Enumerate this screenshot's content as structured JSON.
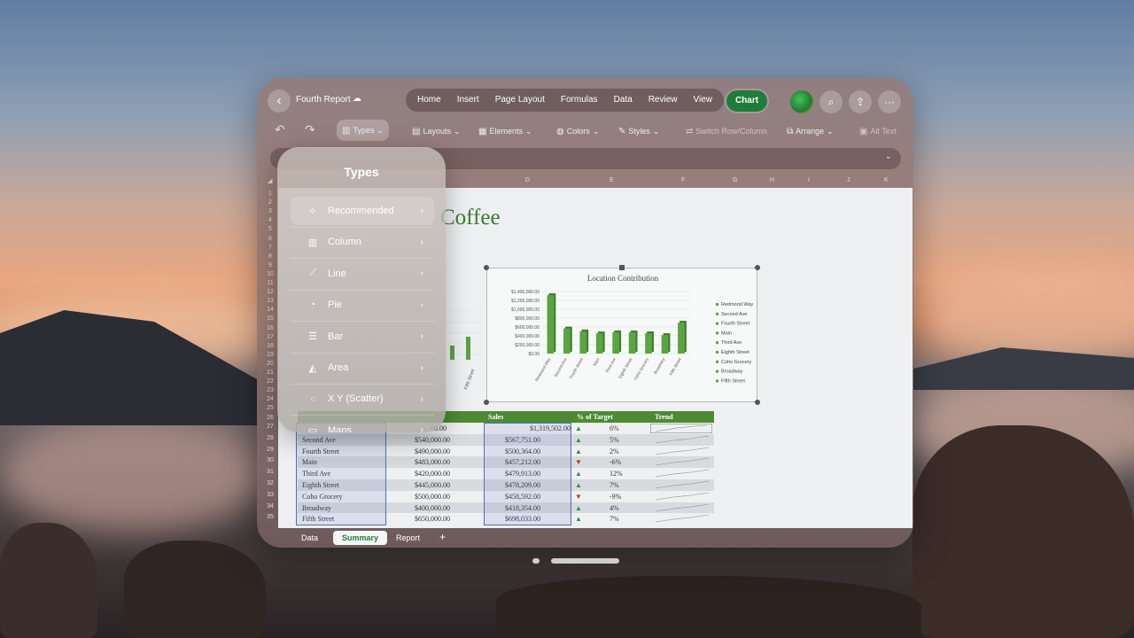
{
  "window": {
    "title": "Fourth Report",
    "tabs": [
      "Home",
      "Insert",
      "Page Layout",
      "Formulas",
      "Data",
      "Review",
      "View"
    ],
    "active_tab": "Chart"
  },
  "ribbon": {
    "types": "Types",
    "layouts": "Layouts",
    "elements": "Elements",
    "colors": "Colors",
    "styles": "Styles",
    "switch": "Switch Row/Column",
    "arrange": "Arrange",
    "alt_text": "Alt Text"
  },
  "columns": [
    "D",
    "E",
    "F",
    "G",
    "H",
    "I",
    "J",
    "K"
  ],
  "rows": [
    "1",
    "2",
    "3",
    "4",
    "5",
    "6",
    "7",
    "8",
    "9",
    "10",
    "11",
    "12",
    "13",
    "14",
    "15",
    "16",
    "17",
    "18",
    "19",
    "20",
    "21",
    "22",
    "23",
    "24",
    "25",
    "26",
    "27",
    "28",
    "29",
    "30",
    "31",
    "32",
    "33",
    "34",
    "35"
  ],
  "sheet_title": "Coffee",
  "types_panel": {
    "title": "Types",
    "items": [
      {
        "label": "Recommended",
        "icon": "wand-icon"
      },
      {
        "label": "Column",
        "icon": "column-chart-icon"
      },
      {
        "label": "Line",
        "icon": "line-chart-icon"
      },
      {
        "label": "Pie",
        "icon": "pie-chart-icon"
      },
      {
        "label": "Bar",
        "icon": "bar-chart-icon"
      },
      {
        "label": "Area",
        "icon": "area-chart-icon"
      },
      {
        "label": "X Y (Scatter)",
        "icon": "scatter-chart-icon"
      },
      {
        "label": "Maps",
        "icon": "map-icon"
      }
    ]
  },
  "chart_data": {
    "type": "bar",
    "title": "Location Contribution",
    "categories": [
      "Redmond Way",
      "Second Ave",
      "Fourth Street",
      "Main",
      "Third Ave",
      "Eighth Street",
      "Coho Grocery",
      "Broadway",
      "Fifth Street"
    ],
    "values": [
      1319502,
      567751,
      500364,
      457212,
      479913,
      478209,
      458592,
      418354,
      698033
    ],
    "ylim": [
      0,
      1400000
    ],
    "yticks": [
      "$0.00",
      "$200,000.00",
      "$400,000.00",
      "$600,000.00",
      "$800,000.00",
      "$1,000,000.00",
      "$1,200,000.00",
      "$1,400,000.00"
    ],
    "legend": [
      "Redmond Way",
      "Second Ave",
      "Fourth Street",
      "Main",
      "Third Ave",
      "Eighth Street",
      "Coho Grocery",
      "Broadway",
      "Fifth Street"
    ],
    "legend_position": "right",
    "bar_color": "#5aa443"
  },
  "table": {
    "headers": [
      "Sales",
      "% of Target",
      "Trend"
    ],
    "first_row_partial": {
      "target": "00.00",
      "sales": "$1,319,502.00",
      "pct": "6%",
      "dir": "up"
    },
    "rows": [
      {
        "name": "Second Ave",
        "target": "$540,000.00",
        "sales": "$567,751.00",
        "pct": "5%",
        "dir": "up"
      },
      {
        "name": "Fourth Street",
        "target": "$490,000.00",
        "sales": "$500,364.00",
        "pct": "2%",
        "dir": "up"
      },
      {
        "name": "Main",
        "target": "$483,000.00",
        "sales": "$457,212.00",
        "pct": "-6%",
        "dir": "down"
      },
      {
        "name": "Third Ave",
        "target": "$420,000.00",
        "sales": "$479,913.00",
        "pct": "12%",
        "dir": "up"
      },
      {
        "name": "Eighth Street",
        "target": "$445,000.00",
        "sales": "$478,209.00",
        "pct": "7%",
        "dir": "up"
      },
      {
        "name": "Coho Grocery",
        "target": "$500,000.00",
        "sales": "$458,592.00",
        "pct": "-9%",
        "dir": "down"
      },
      {
        "name": "Broadway",
        "target": "$400,000.00",
        "sales": "$418,354.00",
        "pct": "4%",
        "dir": "up"
      },
      {
        "name": "Fifth Street",
        "target": "$650,000.00",
        "sales": "$698,033.00",
        "pct": "7%",
        "dir": "up"
      }
    ]
  },
  "sheet_tabs": [
    "Data",
    "Summary",
    "Report"
  ],
  "add_sheet": "+"
}
